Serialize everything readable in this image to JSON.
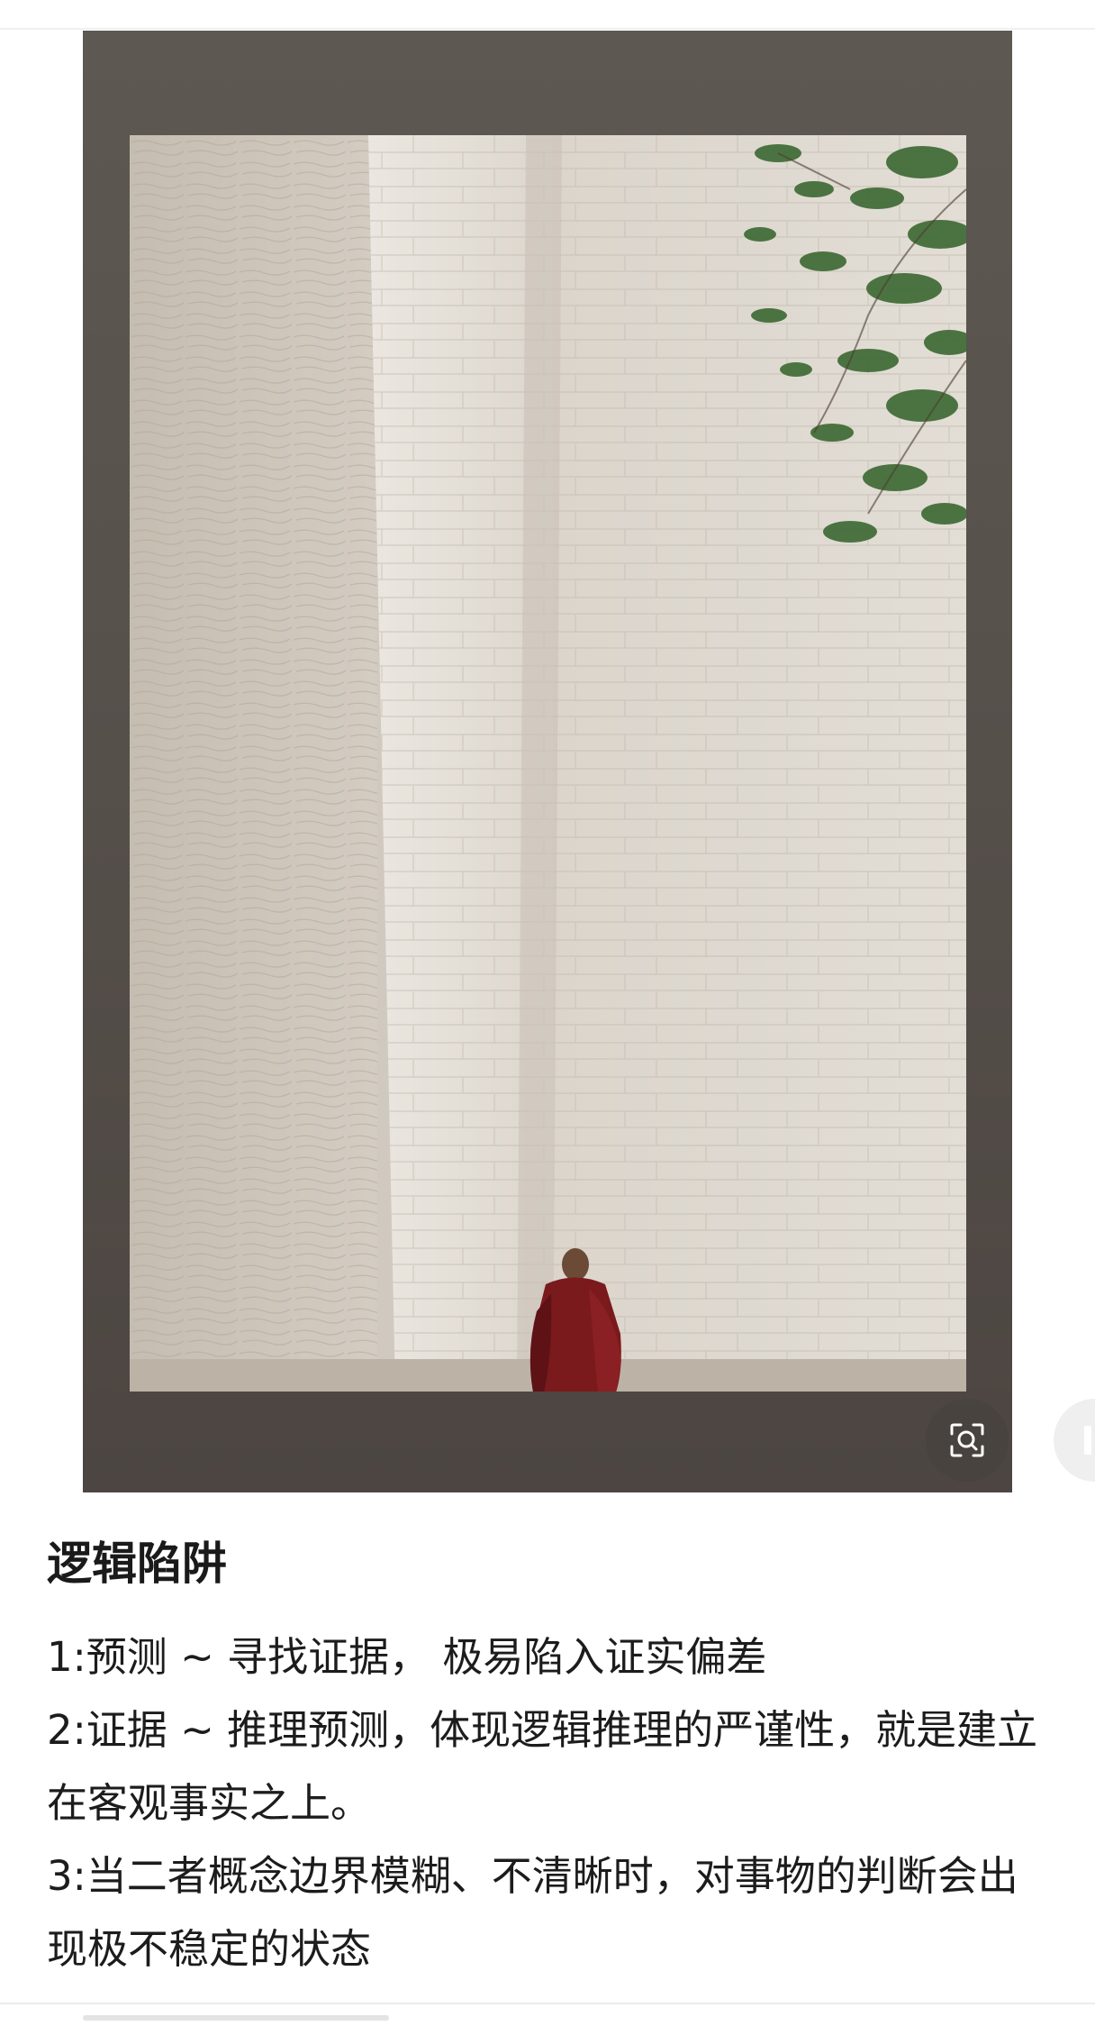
{
  "image": {
    "icons": {
      "lens": "image-search-icon",
      "pause": "pause-icon"
    }
  },
  "article": {
    "title": "逻辑陷阱",
    "paragraphs": [
      "1:预测 ~ 寻找证据， 极易陷入证实偏差",
      "2:证据 ~ 推理预测，体现逻辑推理的严谨性，就是建立在客观事实之上。",
      "3:当二者概念边界模糊、不清晰时，对事物的判断会出现极不稳定的状态"
    ]
  },
  "colors": {
    "frame": "#56504b",
    "wall": "#d9d3c9",
    "robe": "#7a1a1c",
    "leaves": "#3f6b35"
  }
}
